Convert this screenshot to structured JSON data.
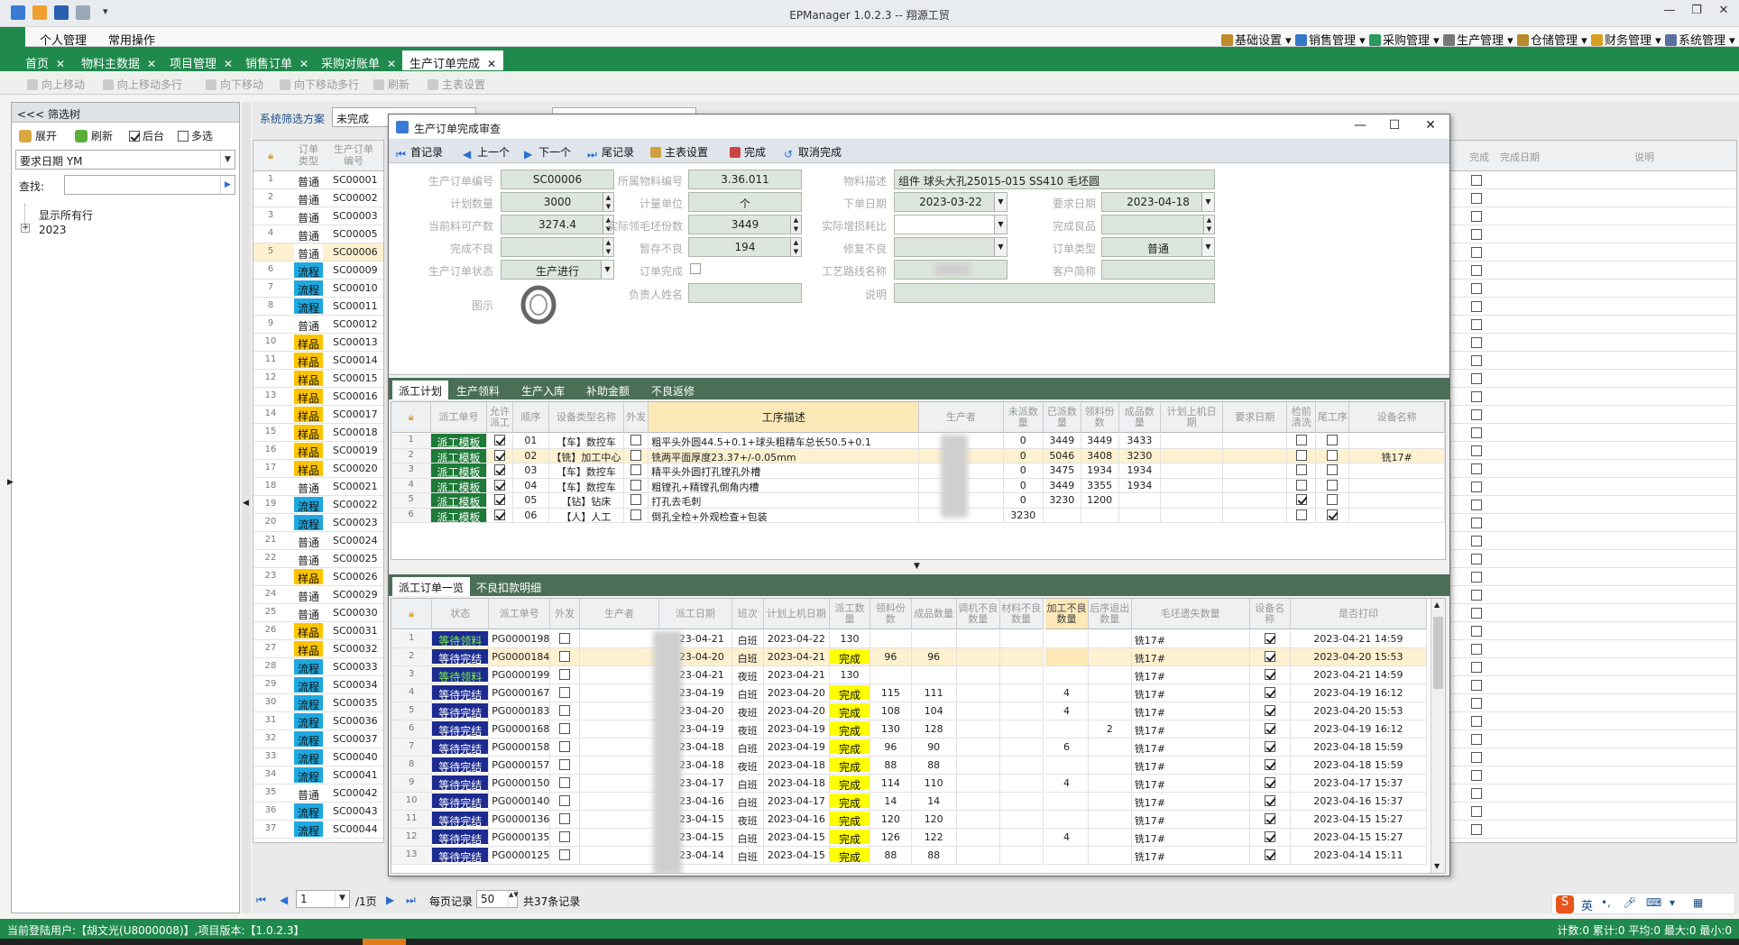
{
  "window": {
    "title": "EPManager 1.0.2.3 -- 翔源工贸"
  },
  "menus": {
    "left": [
      "个人管理",
      "常用操作"
    ],
    "right": [
      "基础设置",
      "销售管理",
      "采购管理",
      "生产管理",
      "仓储管理",
      "财务管理",
      "系统管理"
    ]
  },
  "tabs": [
    "首页",
    "物料主数据",
    "项目管理",
    "销售订单",
    "采购对账单",
    "生产订单完成"
  ],
  "toolbar": [
    "向上移动",
    "向上移动多行",
    "向下移动",
    "向下移动多行",
    "刷新",
    "主表设置"
  ],
  "left_panel": {
    "header": "<<< 筛选树",
    "expand": "展开",
    "refresh": "刷新",
    "background": "后台",
    "multi": "多选",
    "combo": "要求日期 YM",
    "find_label": "查找:",
    "tree_all": "显示所有行",
    "tree_year": "2023"
  },
  "filter": {
    "label": "系统筛选方案",
    "value": "未完成"
  },
  "grid1": {
    "h_type": "订单类型",
    "h_no": "生产订单编号",
    "rows": [
      [
        "1",
        "普通",
        "SC00001"
      ],
      [
        "2",
        "普通",
        "SC00002"
      ],
      [
        "3",
        "普通",
        "SC00003"
      ],
      [
        "4",
        "普通",
        "SC00005"
      ],
      [
        "5",
        "普通",
        "SC00006"
      ],
      [
        "6",
        "流程",
        "SC00009"
      ],
      [
        "7",
        "流程",
        "SC00010"
      ],
      [
        "8",
        "流程",
        "SC00011"
      ],
      [
        "9",
        "普通",
        "SC00012"
      ],
      [
        "10",
        "样品",
        "SC00013"
      ],
      [
        "11",
        "样品",
        "SC00014"
      ],
      [
        "12",
        "样品",
        "SC00015"
      ],
      [
        "13",
        "样品",
        "SC00016"
      ],
      [
        "14",
        "样品",
        "SC00017"
      ],
      [
        "15",
        "样品",
        "SC00018"
      ],
      [
        "16",
        "样品",
        "SC00019"
      ],
      [
        "17",
        "样品",
        "SC00020"
      ],
      [
        "18",
        "普通",
        "SC00021"
      ],
      [
        "19",
        "流程",
        "SC00022"
      ],
      [
        "20",
        "流程",
        "SC00023"
      ],
      [
        "21",
        "普通",
        "SC00024"
      ],
      [
        "22",
        "普通",
        "SC00025"
      ],
      [
        "23",
        "样品",
        "SC00026"
      ],
      [
        "24",
        "普通",
        "SC00029"
      ],
      [
        "25",
        "普通",
        "SC00030"
      ],
      [
        "26",
        "样品",
        "SC00031"
      ],
      [
        "27",
        "样品",
        "SC00032"
      ],
      [
        "28",
        "流程",
        "SC00033"
      ],
      [
        "29",
        "流程",
        "SC00034"
      ],
      [
        "30",
        "流程",
        "SC00035"
      ],
      [
        "31",
        "流程",
        "SC00036"
      ],
      [
        "32",
        "流程",
        "SC00037"
      ],
      [
        "33",
        "流程",
        "SC00040"
      ],
      [
        "34",
        "流程",
        "SC00041"
      ],
      [
        "35",
        "普通",
        "SC00042"
      ],
      [
        "36",
        "流程",
        "SC00043"
      ],
      [
        "37",
        "流程",
        "SC00044"
      ]
    ]
  },
  "right_strip": {
    "h_done": "完成",
    "h_date": "完成日期",
    "h_note": "说明"
  },
  "dialog": {
    "title": "生产订单完成审查",
    "toolbar": [
      "首记录",
      "上一个",
      "下一个",
      "尾记录",
      "主表设置",
      "完成",
      "取消完成"
    ],
    "form": {
      "order_no_l": "生产订单编号",
      "order_no": "SC00006",
      "mat_no_l": "所属物料编号",
      "mat_no": "3.36.011",
      "mat_desc_l": "物料描述",
      "mat_desc": "组件 球头大孔25015-015 SS410 毛坯圆",
      "plan_qty_l": "计划数量",
      "plan_qty": "3000",
      "unit_l": "计量单位",
      "unit": "个",
      "order_date_l": "下单日期",
      "order_date": "2023-03-22",
      "req_date_l": "要求日期",
      "req_date": "2023-04-18",
      "avail_l": "当前料可产数",
      "avail": "3274.4",
      "act_l": "实际领毛坯份数",
      "act": "3449",
      "loss_l": "实际增损耗比",
      "loss": "",
      "good_l": "完成良品",
      "good": "",
      "bad_l": "完成不良",
      "bad": "",
      "hold_l": "暂存不良",
      "hold": "194",
      "repair_l": "修复不良",
      "repair": "",
      "otype_l": "订单类型",
      "otype": "普通",
      "status_l": "生产订单状态",
      "status": "生产进行",
      "done_l": "订单完成",
      "route_l": "工艺路线名称",
      "cust_l": "客户简称",
      "img_l": "图示",
      "owner_l": "负责人姓名",
      "note_l": "说明"
    },
    "subtabs1": [
      "派工计划",
      "生产领料",
      "生产入库",
      "补助金额",
      "不良返修"
    ],
    "plan": {
      "headers": [
        "派工单号",
        "允许派工",
        "顺序",
        "设备类型名称",
        "外发",
        "工序描述",
        "生产者",
        "未派数量",
        "已派数量",
        "领料份数",
        "成品数量",
        "计划上机日期",
        "要求日期",
        "检前清洗",
        "尾工序",
        "设备名称"
      ],
      "rows": [
        [
          "1",
          "派工模板",
          "01",
          "【车】数控车",
          "粗平头外圆44.5+0.1+球头粗精车总长50.5+0.1",
          "0",
          "3449",
          "3449",
          "3433",
          ""
        ],
        [
          "2",
          "派工模板",
          "02",
          "【铣】加工中心",
          "铣两平面厚度23.37+/-0.05mm",
          "0",
          "5046",
          "3408",
          "3230",
          "铣17#"
        ],
        [
          "3",
          "派工模板",
          "03",
          "【车】数控车",
          "精平头外圆打孔镗孔外槽",
          "0",
          "3475",
          "1934",
          "1934",
          ""
        ],
        [
          "4",
          "派工模板",
          "04",
          "【车】数控车",
          "粗镗孔+精镗孔倒角内槽",
          "0",
          "3449",
          "3355",
          "1934",
          ""
        ],
        [
          "5",
          "派工模板",
          "05",
          "【钻】钻床",
          "打孔去毛刺",
          "0",
          "3230",
          "1200",
          "",
          ""
        ],
        [
          "6",
          "派工模板",
          "06",
          "【人】人工",
          "倒孔全检+外观检查+包装",
          "3230",
          "",
          "",
          "",
          ""
        ]
      ]
    },
    "subtabs2": [
      "派工订单一览",
      "不良扣款明细"
    ],
    "dispatch": {
      "headers": [
        "状态",
        "派工单号",
        "外发",
        "生产者",
        "派工日期",
        "班次",
        "计划上机日期",
        "派工数量",
        "领料份数",
        "成品数量",
        "调机不良数量",
        "材料不良数量",
        "加工不良数量",
        "后序退出数量",
        "毛坯遗失数量",
        "设备名称",
        "是否打印",
        "打印时间"
      ],
      "rows": [
        [
          "1",
          "等待领料",
          "PG0000198",
          "2023-04-21",
          "白班",
          "2023-04-22",
          "130",
          "",
          "",
          "",
          "",
          "",
          "",
          "",
          "",
          "铣17#",
          "2023-04-21 14:59"
        ],
        [
          "2",
          "等待完结",
          "PG0000184",
          "2023-04-20",
          "白班",
          "2023-04-21",
          "完成",
          "96",
          "96",
          "",
          "",
          "",
          "",
          "",
          "",
          "铣17#",
          "2023-04-20 15:53"
        ],
        [
          "3",
          "等待领料",
          "PG0000199",
          "2023-04-21",
          "夜班",
          "2023-04-21",
          "130",
          "",
          "",
          "",
          "",
          "",
          "",
          "",
          "",
          "铣17#",
          "2023-04-21 14:59"
        ],
        [
          "4",
          "等待完结",
          "PG0000167",
          "2023-04-19",
          "白班",
          "2023-04-20",
          "完成",
          "115",
          "111",
          "",
          "",
          "4",
          "",
          "",
          "",
          "铣17#",
          "2023-04-19 16:12"
        ],
        [
          "5",
          "等待完结",
          "PG0000183",
          "2023-04-20",
          "夜班",
          "2023-04-20",
          "完成",
          "108",
          "104",
          "",
          "",
          "4",
          "",
          "",
          "",
          "铣17#",
          "2023-04-20 15:53"
        ],
        [
          "6",
          "等待完结",
          "PG0000168",
          "2023-04-19",
          "夜班",
          "2023-04-19",
          "完成",
          "130",
          "128",
          "",
          "",
          "",
          "2",
          "",
          "",
          "铣17#",
          "2023-04-19 16:12"
        ],
        [
          "7",
          "等待完结",
          "PG0000158",
          "2023-04-18",
          "白班",
          "2023-04-19",
          "完成",
          "96",
          "90",
          "",
          "",
          "6",
          "",
          "",
          "",
          "铣17#",
          "2023-04-18 15:59"
        ],
        [
          "8",
          "等待完结",
          "PG0000157",
          "2023-04-18",
          "夜班",
          "2023-04-18",
          "完成",
          "88",
          "88",
          "",
          "",
          "",
          "",
          "",
          "",
          "铣17#",
          "2023-04-18 15:59"
        ],
        [
          "9",
          "等待完结",
          "PG0000150",
          "2023-04-17",
          "白班",
          "2023-04-18",
          "完成",
          "114",
          "110",
          "",
          "",
          "4",
          "",
          "",
          "",
          "铣17#",
          "2023-04-17 15:37"
        ],
        [
          "10",
          "等待完结",
          "PG0000140",
          "2023-04-16",
          "白班",
          "2023-04-17",
          "完成",
          "14",
          "14",
          "",
          "",
          "",
          "",
          "",
          "",
          "铣17#",
          "2023-04-16 15:37"
        ],
        [
          "11",
          "等待完结",
          "PG0000136",
          "2023-04-15",
          "夜班",
          "2023-04-16",
          "完成",
          "120",
          "120",
          "",
          "",
          "",
          "",
          "",
          "",
          "铣17#",
          "2023-04-15 15:27"
        ],
        [
          "12",
          "等待完结",
          "PG0000135",
          "2023-04-15",
          "白班",
          "2023-04-15",
          "完成",
          "126",
          "122",
          "",
          "",
          "4",
          "",
          "",
          "",
          "铣17#",
          "2023-04-15 15:27"
        ],
        [
          "13",
          "等待完结",
          "PG0000125",
          "2023-04-14",
          "白班",
          "2023-04-15",
          "完成",
          "88",
          "88",
          "",
          "",
          "",
          "",
          "",
          "",
          "铣17#",
          "2023-04-14 15:11"
        ]
      ]
    }
  },
  "pager": {
    "page": "1",
    "of": "/1页",
    "per_label": "每页记录",
    "per": "50",
    "total": "共37条记录"
  },
  "status": {
    "left": "当前登陆用户:【胡文光(U8000008)】,项目版本:【1.0.2.3】",
    "right": "计数:0 累计:0 平均:0 最大:0 最小:0"
  },
  "ime": {
    "lang": "英"
  },
  "colors": {
    "green": "#1f8a4c",
    "flow": "#1ea8e0",
    "sample": "#ffc400",
    "yellow_done": "#ffff00"
  }
}
